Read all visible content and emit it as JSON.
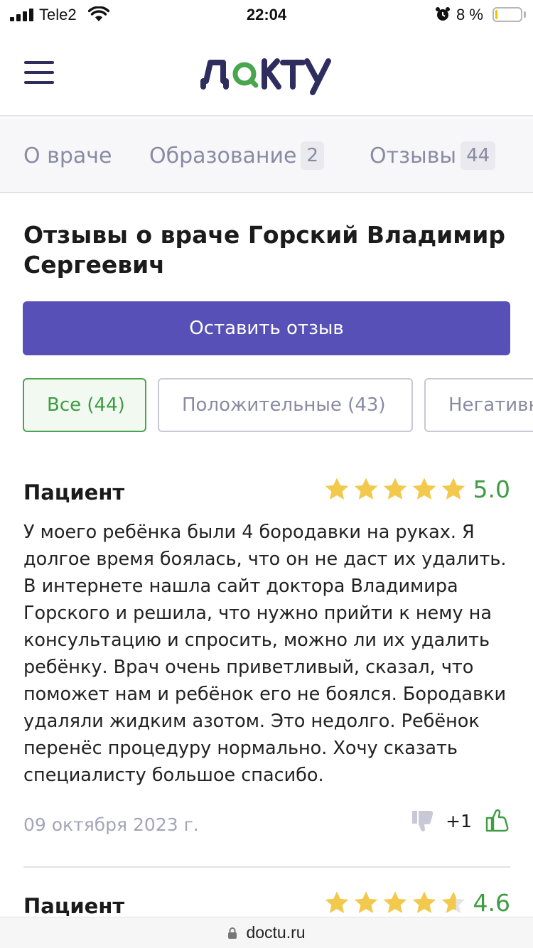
{
  "status_bar": {
    "carrier": "Tele2",
    "time": "22:04",
    "battery": "8 %",
    "battery_level": 0.08
  },
  "header": {
    "logo_text": "доктy",
    "menu_icon": "hamburger-icon"
  },
  "tabs": [
    {
      "label": "О враче",
      "count": ""
    },
    {
      "label": "Образование",
      "count": "2"
    },
    {
      "label": "Отзывы",
      "count": "44"
    }
  ],
  "page": {
    "title": "Отзывы о враче Горский Владимир Сергеевич",
    "leave_review": "Оставить отзыв"
  },
  "filters": [
    {
      "label": "Все (44)",
      "active": true
    },
    {
      "label": "Положительные (43)",
      "active": false
    },
    {
      "label": "Негативные",
      "active": false
    }
  ],
  "reviews": [
    {
      "author": "Пациент",
      "rating": "5.0",
      "rating_value": 5.0,
      "text": "У моего ребёнка были 4 бородавки на руках. Я долгое время боялась, что он не даст их удалить. В интернете нашла сайт доктора Владимира Горского и решила, что нужно прийти к нему на консультацию и спросить, можно ли их удалить ребёнку. Врач очень приветливый, сказал, что поможет нам и ребёнок его не боялся. Бородавки удаляли жидким азотом. Это недолго. Ребёнок перенёс процедуру нормально. Хочу сказать специалисту большое спасибо.",
      "date": "09 октября 2023 г.",
      "votes": "+1"
    },
    {
      "author": "Пациент",
      "rating": "4.6",
      "rating_value": 4.6
    }
  ],
  "url_bar": {
    "url": "doctu.ru"
  },
  "colors": {
    "accent": "#5750b6",
    "green": "#3e9c43",
    "star": "#f2c94c",
    "star_empty": "#e3e3ea"
  }
}
